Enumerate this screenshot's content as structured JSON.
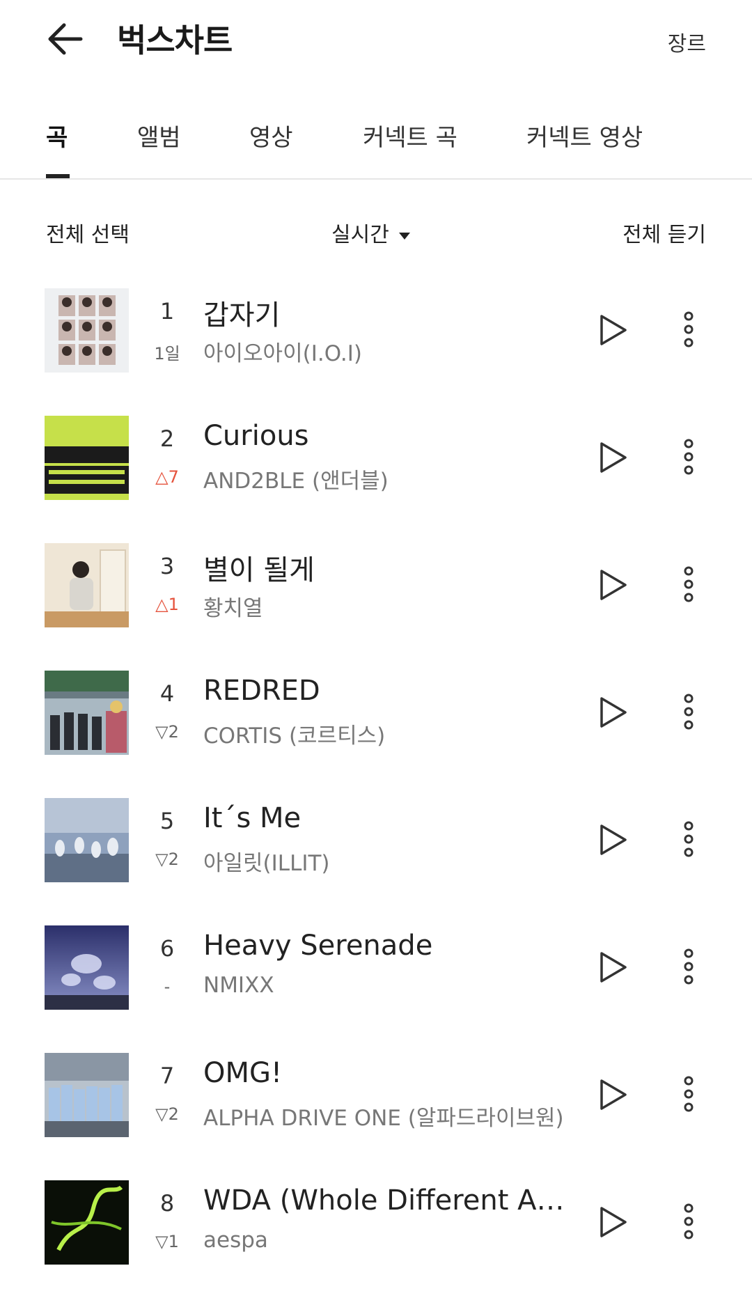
{
  "header": {
    "title": "벅스차트",
    "genre_label": "장르"
  },
  "tabs": [
    {
      "label": "곡",
      "active": true
    },
    {
      "label": "앨범"
    },
    {
      "label": "영상"
    },
    {
      "label": "커넥트 곡"
    },
    {
      "label": "커넥트 영상"
    }
  ],
  "controls": {
    "select_all": "전체 선택",
    "period": "실시간",
    "play_all": "전체 듣기"
  },
  "colors": {
    "rank_up": "#e5533d",
    "rank_down": "#666666",
    "text": "#222222",
    "subtext": "#777777"
  },
  "songs": [
    {
      "rank": "1",
      "change": "1일",
      "title": "갑자기",
      "artist": "아이오아이(I.O.I)"
    },
    {
      "rank": "2",
      "change": "△7",
      "title": "Curious",
      "artist": "AND2BLE (앤더블)"
    },
    {
      "rank": "3",
      "change": "△1",
      "title": "별이 될게",
      "artist": "황치열"
    },
    {
      "rank": "4",
      "change": "▽2",
      "title": "REDRED",
      "artist": "CORTIS (코르티스)"
    },
    {
      "rank": "5",
      "change": "▽2",
      "title": "It´s Me",
      "artist": "아일릿(ILLIT)"
    },
    {
      "rank": "6",
      "change": "-",
      "title": "Heavy Serenade",
      "artist": "NMIXX"
    },
    {
      "rank": "7",
      "change": "▽2",
      "title": "OMG!",
      "artist": "ALPHA DRIVE ONE (알파드라이브원)"
    },
    {
      "rank": "8",
      "change": "▽1",
      "title": "WDA (Whole Different Anim…",
      "artist": "aespa"
    }
  ]
}
